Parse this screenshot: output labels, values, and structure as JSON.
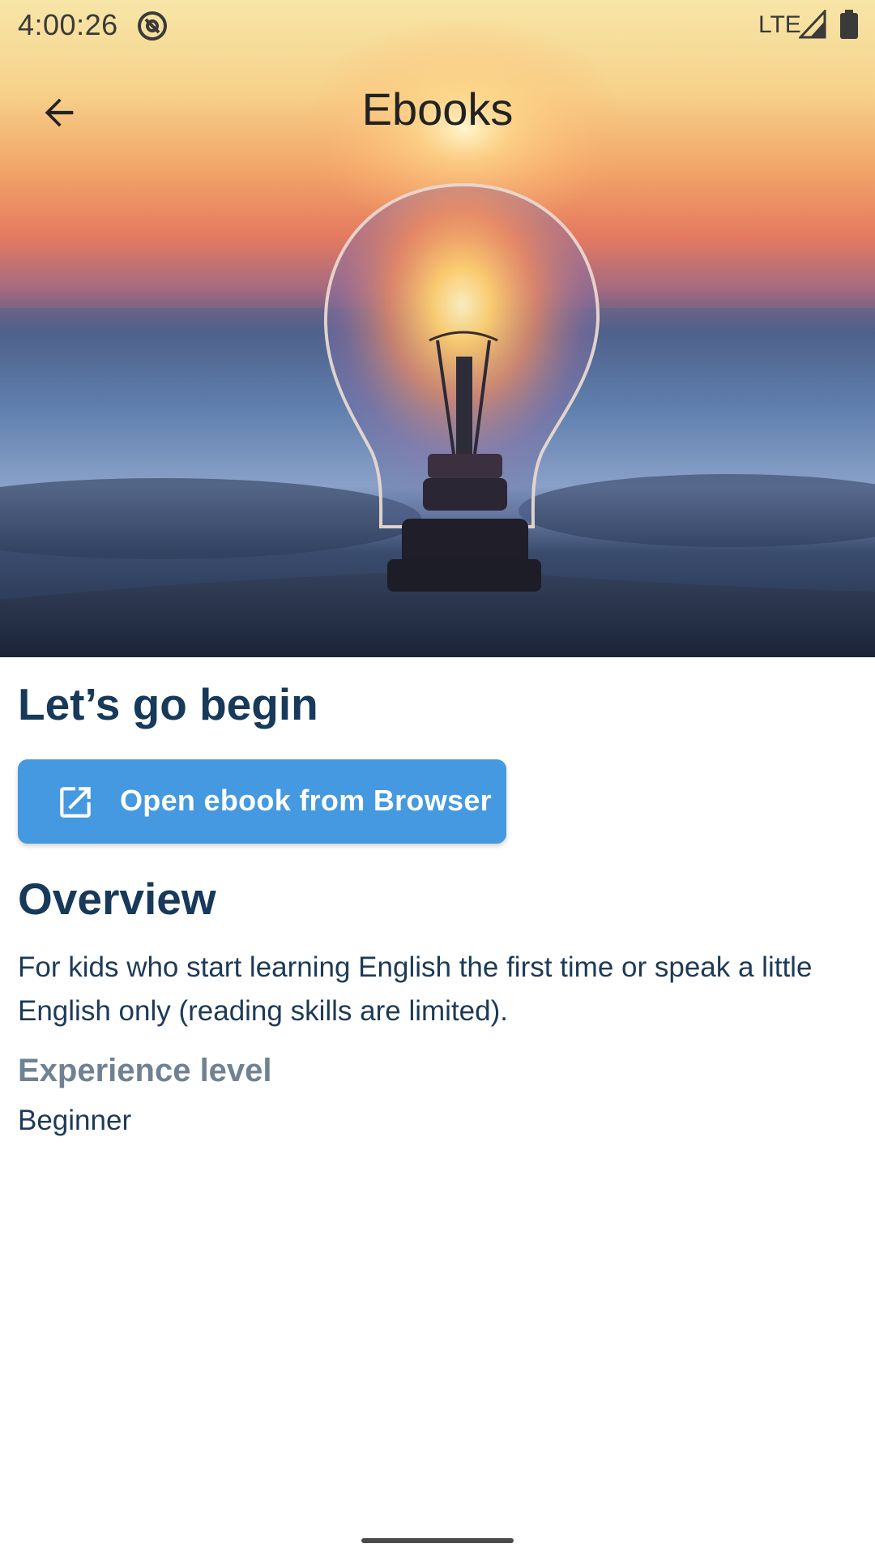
{
  "status_bar": {
    "time": "4:00:26",
    "network": "LTE",
    "notification_icon": "at-sign-icon",
    "signal_icon": "signal-icon",
    "battery_icon": "battery-icon"
  },
  "app_bar": {
    "title": "Ebooks",
    "back_icon": "arrow-back-icon"
  },
  "hero": {
    "image": "lightbulb-sunset-image"
  },
  "content": {
    "headline": "Let’s go begin",
    "open_button": {
      "label": "Open ebook from Browser",
      "icon": "open-in-new-icon",
      "color": "#4499e0"
    },
    "overview_title": "Overview",
    "description": "For kids who start learning English the first time or speak a little English only (reading skills are limited).",
    "experience_label": "Experience level",
    "experience_value": "Beginner"
  },
  "colors": {
    "heading": "#17395a",
    "body_text": "#1d3a57",
    "muted_label": "#6f8294",
    "button": "#4499e0"
  }
}
